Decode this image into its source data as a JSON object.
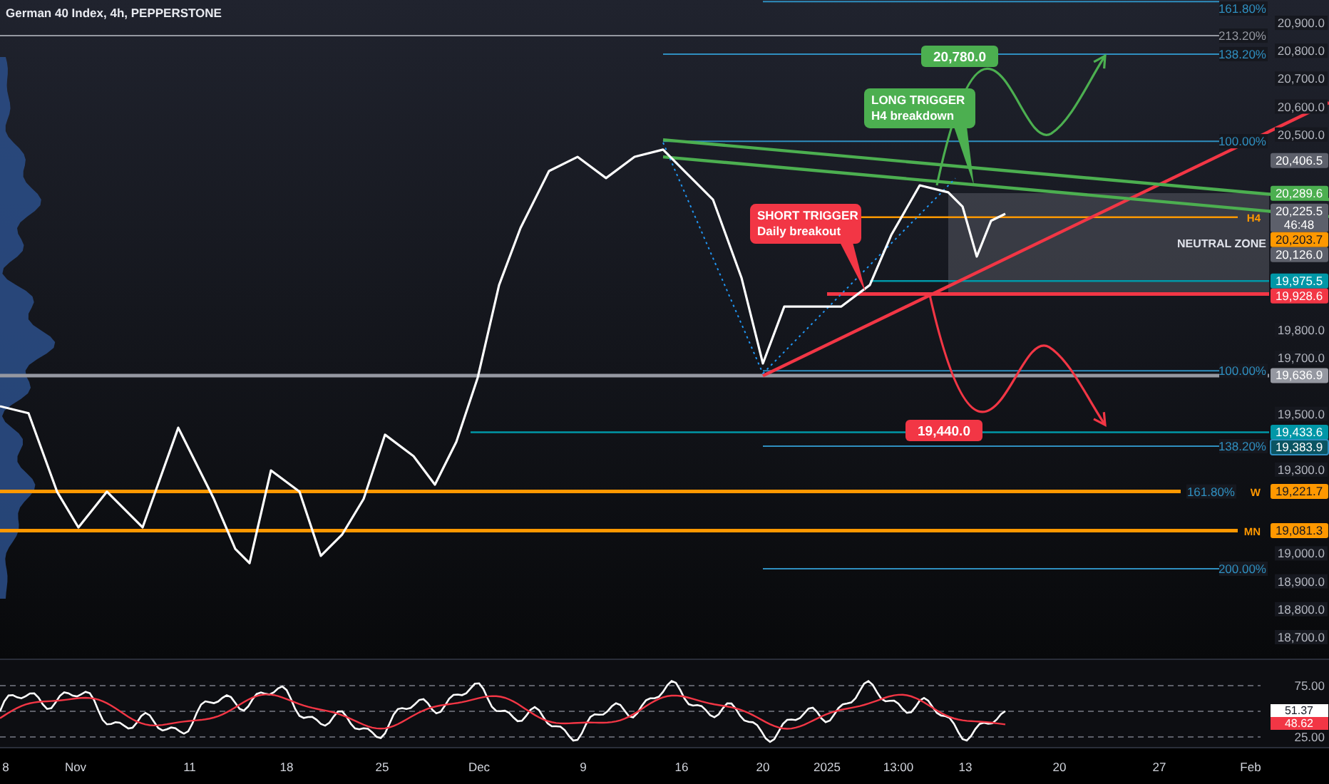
{
  "title": "German 40 Index, 4h, PEPPERSTONE",
  "levels": [
    {
      "kind": "fib",
      "color": "#2f8fc0",
      "label": "161.80%"
    },
    {
      "kind": "fib",
      "color": "#9598a1",
      "label": "213.20%"
    },
    {
      "kind": "fib",
      "color": "#2f8fc0",
      "label": "138.20%"
    },
    {
      "kind": "fib",
      "color": "#2f8fc0",
      "label": "100.00%"
    },
    {
      "kind": "marker",
      "color": "#5d606b",
      "badge": "20,406.5"
    },
    {
      "kind": "marker",
      "color": "#4caf50",
      "badge": "20,289.6"
    },
    {
      "kind": "marker",
      "color": "#5d606b",
      "badge": "20,225.5",
      "badge_sub": "46:48"
    },
    {
      "kind": "level",
      "color": "#ff9800",
      "tag": "H4",
      "badge": "20,203.7"
    },
    {
      "kind": "marker",
      "color": "#5d606b",
      "badge": "20,126.0"
    },
    {
      "kind": "level",
      "color": "#0097a7",
      "badge": "19,975.5"
    },
    {
      "kind": "major",
      "color": "#f23645",
      "badge": "19,928.6"
    },
    {
      "kind": "fib",
      "color": "#2f8fc0",
      "label": "100.00%"
    },
    {
      "kind": "major",
      "color": "#9598a1",
      "badge": "19,636.9"
    },
    {
      "kind": "level",
      "color": "#0097a7",
      "badge": "19,433.6"
    },
    {
      "kind": "fib",
      "color": "#2f8fc0",
      "label": "138.20%",
      "badge": "19,383.9",
      "outlined": true
    },
    {
      "kind": "major",
      "color": "#ff9800",
      "label": "161.80%",
      "tag": "W",
      "badge": "19,221.7"
    },
    {
      "kind": "major",
      "color": "#ff9800",
      "tag": "MN",
      "badge": "19,081.3"
    },
    {
      "kind": "fib",
      "color": "#2f8fc0",
      "label": "200.00%"
    }
  ],
  "zone": {
    "label": "NEUTRAL ZONE",
    "color": "#787b86"
  },
  "trend_lines": [
    {
      "kind": "solid",
      "color": "#f23645"
    },
    {
      "kind": "solid",
      "color": "#4caf50"
    },
    {
      "kind": "solid",
      "color": "#4caf50"
    },
    {
      "kind": "dotted",
      "color": "#2196f3"
    },
    {
      "kind": "dotted",
      "color": "#2196f3"
    }
  ],
  "arrows": [
    {
      "color": "#4caf50"
    },
    {
      "color": "#f23645"
    }
  ],
  "targets": [
    {
      "text": "20,780.0",
      "color": "#4caf50"
    },
    {
      "text": "19,440.0",
      "color": "#f23645"
    }
  ],
  "notes": [
    {
      "color": "#4caf50",
      "lines": [
        "LONG TRIGGER",
        "H4 breakdown"
      ]
    },
    {
      "color": "#f23645",
      "lines": [
        "SHORT TRIGGER",
        "Daily breakout"
      ]
    }
  ],
  "price_axis": [
    "20,900.0",
    "20,800.0",
    "20,700.0",
    "20,600.0",
    "20,500.0",
    "19,800.0",
    "19,700.0",
    "19,500.0",
    "19,300.0",
    "19,000.0",
    "18,900.0",
    "18,800.0",
    "18,700.0"
  ],
  "time_axis": [
    "8",
    "Nov",
    "11",
    "18",
    "25",
    "Dec",
    "9",
    "16",
    "20",
    "2025",
    "13:00",
    "13",
    "20",
    "27",
    "Feb"
  ],
  "rsi": {
    "axis": [
      "75.00",
      "25.00"
    ],
    "badges": [
      {
        "text": "51.37",
        "color": "#ffffff"
      },
      {
        "text": "48.62",
        "color": "#f23645"
      }
    ]
  }
}
